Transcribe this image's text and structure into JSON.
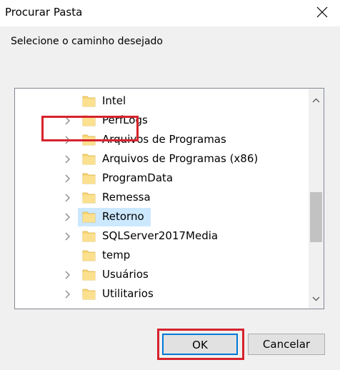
{
  "window": {
    "title": "Procurar Pasta"
  },
  "instruction": "Selecione o caminho desejado",
  "tree": {
    "items": [
      {
        "label": "Intel",
        "has_children": false,
        "selected": false
      },
      {
        "label": "PerfLogs",
        "has_children": true,
        "selected": false
      },
      {
        "label": "Arquivos de Programas",
        "has_children": true,
        "selected": false
      },
      {
        "label": "Arquivos de Programas (x86)",
        "has_children": true,
        "selected": false
      },
      {
        "label": "ProgramData",
        "has_children": true,
        "selected": false
      },
      {
        "label": "Remessa",
        "has_children": true,
        "selected": false
      },
      {
        "label": "Retorno",
        "has_children": true,
        "selected": true
      },
      {
        "label": "SQLServer2017Media",
        "has_children": true,
        "selected": false
      },
      {
        "label": "temp",
        "has_children": false,
        "selected": false
      },
      {
        "label": "Usuários",
        "has_children": true,
        "selected": false
      },
      {
        "label": "Utilitarios",
        "has_children": true,
        "selected": false
      }
    ]
  },
  "buttons": {
    "ok": "OK",
    "cancel": "Cancelar"
  },
  "colors": {
    "highlight": "#d6232e",
    "selection": "#cce8ff",
    "folder": "#f8d775",
    "accent": "#0078d7"
  }
}
